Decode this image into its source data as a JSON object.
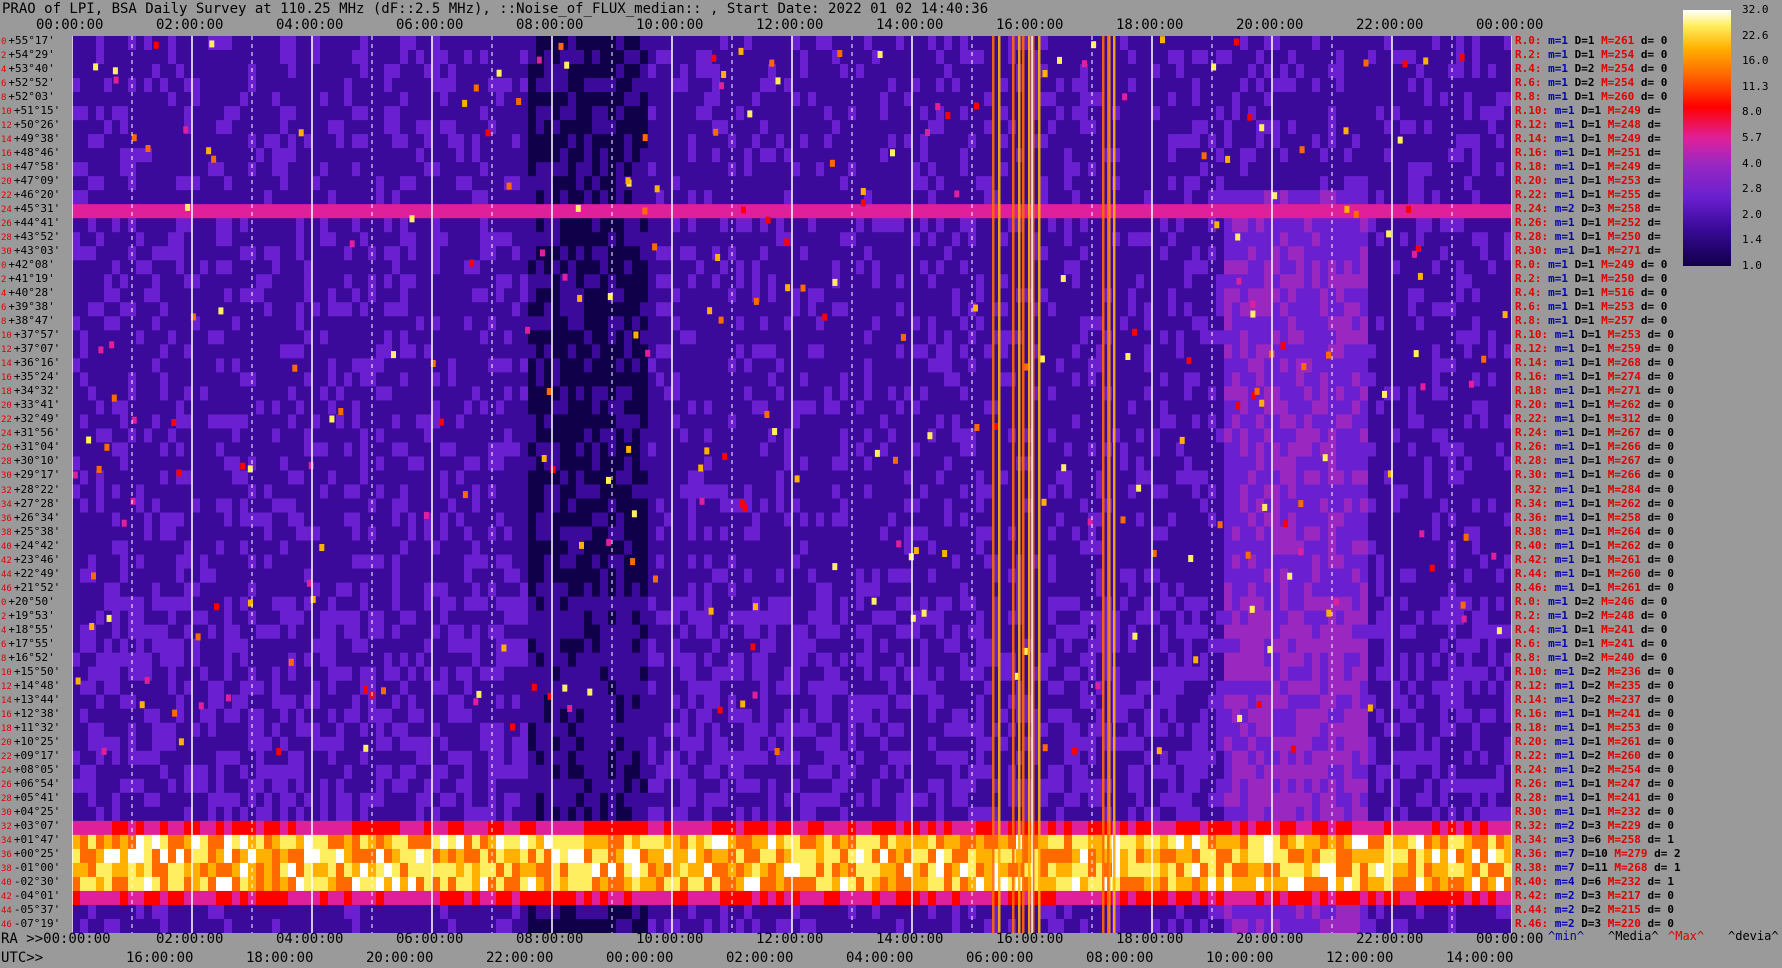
{
  "title": "PRAO of LPI, BSA Daily Survey at 110.25 MHz (dF::2.5 MHz), ::Noise_of_FLUX_median:: , Start Date: 2022 01 02 14:40:36",
  "chart_data": {
    "type": "heatmap",
    "x_ra_ticks": [
      "00:00:00",
      "02:00:00",
      "04:00:00",
      "06:00:00",
      "08:00:00",
      "10:00:00",
      "12:00:00",
      "14:00:00",
      "16:00:00",
      "18:00:00",
      "20:00:00",
      "22:00:00",
      "00:00:00"
    ],
    "x_utc_ticks": [
      "16:00:00",
      "18:00:00",
      "20:00:00",
      "22:00:00",
      "00:00:00",
      "02:00:00",
      "04:00:00",
      "06:00:00",
      "08:00:00",
      "10:00:00",
      "12:00:00",
      "14:00:00"
    ],
    "x_axis_prefix_ra": "RA >>00:00:00",
    "x_axis_prefix_utc": "UTC>>",
    "declinations": [
      "+55°17'",
      "+54°29'",
      "+53°40'",
      "+52°52'",
      "+52°03'",
      "+51°15'",
      "+50°26'",
      "+49°38'",
      "+48°46'",
      "+47°58'",
      "+47°09'",
      "+46°20'",
      "+45°31'",
      "+44°41'",
      "+43°52'",
      "+43°03'",
      "+42°08'",
      "+41°19'",
      "+40°28'",
      "+39°38'",
      "+38°47'",
      "+37°57'",
      "+37°07'",
      "+36°16'",
      "+35°24'",
      "+34°32'",
      "+33°41'",
      "+32°49'",
      "+31°56'",
      "+31°04'",
      "+30°10'",
      "+29°17'",
      "+28°22'",
      "+27°28'",
      "+26°34'",
      "+25°38'",
      "+24°42'",
      "+23°46'",
      "+22°49'",
      "+21°52'",
      "+20°50'",
      "+19°53'",
      "+18°55'",
      "+17°55'",
      "+16°52'",
      "+15°50'",
      "+14°48'",
      "+13°44'",
      "+12°38'",
      "+11°32'",
      "+10°25'",
      "+09°17'",
      "+08°05'",
      "+06°54'",
      "+05°41'",
      "+04°25'",
      "+03°07'",
      "+01°47'",
      "+00°25'",
      "-01°00'",
      "-02°30'",
      "-04°01'",
      "-05°37'",
      "-07°19'"
    ],
    "dec_indices": [
      "0",
      "2",
      "4",
      "6",
      "8",
      "10",
      "12",
      "14",
      "16",
      "18",
      "20",
      "22",
      "24",
      "26",
      "28",
      "30",
      "0",
      "2",
      "4",
      "6",
      "8",
      "10",
      "12",
      "14",
      "16",
      "18",
      "20",
      "22",
      "24",
      "26",
      "28",
      "30",
      "32",
      "34",
      "36",
      "38",
      "40",
      "42",
      "44",
      "46",
      "0",
      "2",
      "4",
      "6",
      "8",
      "10",
      "12",
      "14",
      "16",
      "18",
      "20",
      "22",
      "24",
      "26",
      "28",
      "30",
      "32",
      "34",
      "36",
      "38",
      "40",
      "42",
      "44",
      "46"
    ],
    "row_stats": [
      [
        "R.0:",
        "m=1",
        "D=1",
        "M=261",
        "d= 0"
      ],
      [
        "R.2:",
        "m=1",
        "D=1",
        "M=254",
        "d= 0"
      ],
      [
        "R.4:",
        "m=1",
        "D=2",
        "M=254",
        "d= 0"
      ],
      [
        "R.6:",
        "m=1",
        "D=2",
        "M=254",
        "d= 0"
      ],
      [
        "R.8:",
        "m=1",
        "D=1",
        "M=260",
        "d= 0"
      ],
      [
        "R.10:",
        "m=1",
        "D=1",
        "M=249",
        "d="
      ],
      [
        "R.12:",
        "m=1",
        "D=1",
        "M=248",
        "d="
      ],
      [
        "R.14:",
        "m=1",
        "D=1",
        "M=249",
        "d="
      ],
      [
        "R.16:",
        "m=1",
        "D=1",
        "M=251",
        "d="
      ],
      [
        "R.18:",
        "m=1",
        "D=1",
        "M=249",
        "d="
      ],
      [
        "R.20:",
        "m=1",
        "D=1",
        "M=253",
        "d="
      ],
      [
        "R.22:",
        "m=1",
        "D=1",
        "M=255",
        "d="
      ],
      [
        "R.24:",
        "m=2",
        "D=3",
        "M=258",
        "d="
      ],
      [
        "R.26:",
        "m=1",
        "D=1",
        "M=252",
        "d="
      ],
      [
        "R.28:",
        "m=1",
        "D=1",
        "M=250",
        "d="
      ],
      [
        "R.30:",
        "m=1",
        "D=1",
        "M=271",
        "d="
      ],
      [
        "R.0:",
        "m=1",
        "D=1",
        "M=249",
        "d= 0"
      ],
      [
        "R.2:",
        "m=1",
        "D=1",
        "M=250",
        "d= 0"
      ],
      [
        "R.4:",
        "m=1",
        "D=1",
        "M=516",
        "d= 0"
      ],
      [
        "R.6:",
        "m=1",
        "D=1",
        "M=253",
        "d= 0"
      ],
      [
        "R.8:",
        "m=1",
        "D=1",
        "M=257",
        "d= 0"
      ],
      [
        "R.10:",
        "m=1",
        "D=1",
        "M=253",
        "d= 0"
      ],
      [
        "R.12:",
        "m=1",
        "D=1",
        "M=259",
        "d= 0"
      ],
      [
        "R.14:",
        "m=1",
        "D=1",
        "M=268",
        "d= 0"
      ],
      [
        "R.16:",
        "m=1",
        "D=1",
        "M=274",
        "d= 0"
      ],
      [
        "R.18:",
        "m=1",
        "D=1",
        "M=271",
        "d= 0"
      ],
      [
        "R.20:",
        "m=1",
        "D=1",
        "M=262",
        "d= 0"
      ],
      [
        "R.22:",
        "m=1",
        "D=1",
        "M=312",
        "d= 0"
      ],
      [
        "R.24:",
        "m=1",
        "D=1",
        "M=267",
        "d= 0"
      ],
      [
        "R.26:",
        "m=1",
        "D=1",
        "M=266",
        "d= 0"
      ],
      [
        "R.28:",
        "m=1",
        "D=1",
        "M=267",
        "d= 0"
      ],
      [
        "R.30:",
        "m=1",
        "D=1",
        "M=266",
        "d= 0"
      ],
      [
        "R.32:",
        "m=1",
        "D=1",
        "M=284",
        "d= 0"
      ],
      [
        "R.34:",
        "m=1",
        "D=1",
        "M=262",
        "d= 0"
      ],
      [
        "R.36:",
        "m=1",
        "D=1",
        "M=258",
        "d= 0"
      ],
      [
        "R.38:",
        "m=1",
        "D=1",
        "M=264",
        "d= 0"
      ],
      [
        "R.40:",
        "m=1",
        "D=1",
        "M=262",
        "d= 0"
      ],
      [
        "R.42:",
        "m=1",
        "D=1",
        "M=261",
        "d= 0"
      ],
      [
        "R.44:",
        "m=1",
        "D=1",
        "M=260",
        "d= 0"
      ],
      [
        "R.46:",
        "m=1",
        "D=1",
        "M=261",
        "d= 0"
      ],
      [
        "R.0:",
        "m=1",
        "D=2",
        "M=246",
        "d= 0"
      ],
      [
        "R.2:",
        "m=1",
        "D=2",
        "M=248",
        "d= 0"
      ],
      [
        "R.4:",
        "m=1",
        "D=1",
        "M=241",
        "d= 0"
      ],
      [
        "R.6:",
        "m=1",
        "D=1",
        "M=241",
        "d= 0"
      ],
      [
        "R.8:",
        "m=1",
        "D=2",
        "M=240",
        "d= 0"
      ],
      [
        "R.10:",
        "m=1",
        "D=2",
        "M=236",
        "d= 0"
      ],
      [
        "R.12:",
        "m=1",
        "D=2",
        "M=235",
        "d= 0"
      ],
      [
        "R.14:",
        "m=1",
        "D=2",
        "M=237",
        "d= 0"
      ],
      [
        "R.16:",
        "m=1",
        "D=1",
        "M=241",
        "d= 0"
      ],
      [
        "R.18:",
        "m=1",
        "D=1",
        "M=253",
        "d= 0"
      ],
      [
        "R.20:",
        "m=1",
        "D=1",
        "M=261",
        "d= 0"
      ],
      [
        "R.22:",
        "m=1",
        "D=2",
        "M=260",
        "d= 0"
      ],
      [
        "R.24:",
        "m=1",
        "D=2",
        "M=254",
        "d= 0"
      ],
      [
        "R.26:",
        "m=1",
        "D=1",
        "M=247",
        "d= 0"
      ],
      [
        "R.28:",
        "m=1",
        "D=1",
        "M=241",
        "d= 0"
      ],
      [
        "R.30:",
        "m=1",
        "D=1",
        "M=232",
        "d= 0"
      ],
      [
        "R.32:",
        "m=2",
        "D=3",
        "M=229",
        "d= 0"
      ],
      [
        "R.34:",
        "m=3",
        "D=6",
        "M=258",
        "d= 1"
      ],
      [
        "R.36:",
        "m=7",
        "D=10",
        "M=279",
        "d= 2"
      ],
      [
        "R.38:",
        "m=7",
        "D=11",
        "M=268",
        "d= 1"
      ],
      [
        "R.40:",
        "m=4",
        "D=6",
        "M=232",
        "d= 1"
      ],
      [
        "R.42:",
        "m=2",
        "D=3",
        "M=217",
        "d= 0"
      ],
      [
        "R.44:",
        "m=2",
        "D=2",
        "M=215",
        "d= 0"
      ],
      [
        "R.46:",
        "m=2",
        "D=3",
        "M=220",
        "d= 0"
      ]
    ],
    "colorbar_ticks": [
      "32.0",
      "22.6",
      "16.0",
      "11.3",
      "8.0",
      "5.7",
      "4.0",
      "2.8",
      "2.0",
      "1.4",
      "1.0"
    ],
    "colorbar_scale": "log",
    "legend": [
      "^min^",
      "^Media^",
      "^Max^",
      "^devia^"
    ],
    "legend_colors": [
      "#0000b0",
      "#000000",
      "#e00000",
      "#000000"
    ],
    "colormap": [
      "#10004a",
      "#3b0a9a",
      "#6a20d0",
      "#9a28c0",
      "#e0209a",
      "#ff0000",
      "#ff6a00",
      "#ffb000",
      "#ffef60",
      "#ffffff"
    ],
    "bright_band_decs": [
      "+01°47'",
      "+00°25'",
      "-01°00'",
      "-02°30'"
    ],
    "highlight_dec": "+45°31'",
    "interference_ra": [
      "15:20:00",
      "15:40:00",
      "15:50:00",
      "16:00:00",
      "17:10:00",
      "17:15:00"
    ]
  }
}
